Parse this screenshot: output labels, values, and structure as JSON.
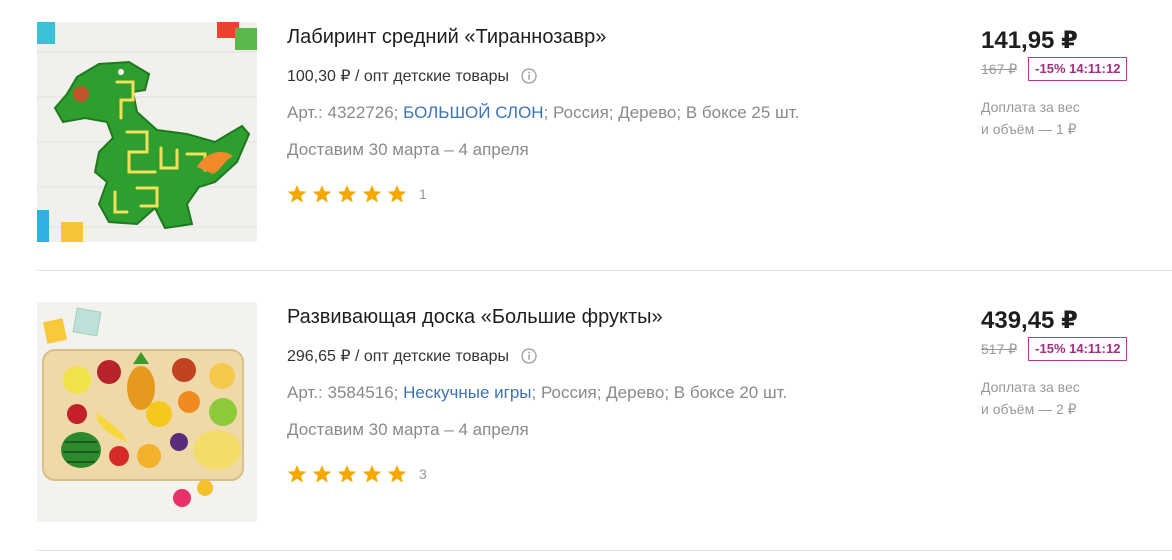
{
  "products": [
    {
      "image_alt": "Лабиринт средний «Тираннозавр»",
      "title": "Лабиринт средний «Тираннозавр»",
      "wholesale_price": "100,30 ₽ / опт детские товары",
      "article": "Арт.: 4322726;",
      "brand": "БОЛЬШОЙ СЛОН",
      "details": "; Россия; Дерево; В боксе 25 шт.",
      "delivery": "Доставим 30 марта – 4 апреля",
      "rating_stars": 5,
      "review_count": "1",
      "price": "141,95 ₽",
      "old_price": "167 ₽",
      "discount_badge": "-15% 14:11:12",
      "surcharge_line1": "Доплата за вес",
      "surcharge_line2": "и объём — 1 ₽"
    },
    {
      "image_alt": "Развивающая доска «Большие фрукты»",
      "title": "Развивающая доска «Большие фрукты»",
      "wholesale_price": "296,65 ₽ / опт детские товары",
      "article": "Арт.: 3584516;",
      "brand": "Нескучные игры",
      "details": "; Россия; Дерево; В боксе 20 шт.",
      "delivery": "Доставим 30 марта – 4 апреля",
      "rating_stars": 5,
      "review_count": "3",
      "price": "439,45 ₽",
      "old_price": "517 ₽",
      "discount_badge": "-15% 14:11:12",
      "surcharge_line1": "Доплата за вес",
      "surcharge_line2": "и объём — 2 ₽"
    }
  ],
  "colors": {
    "brand_link": "#3d74b5",
    "badge": "#a0307f",
    "star": "#f6a800"
  },
  "icons": {
    "info": "info-circle-icon",
    "star": "star-icon"
  }
}
